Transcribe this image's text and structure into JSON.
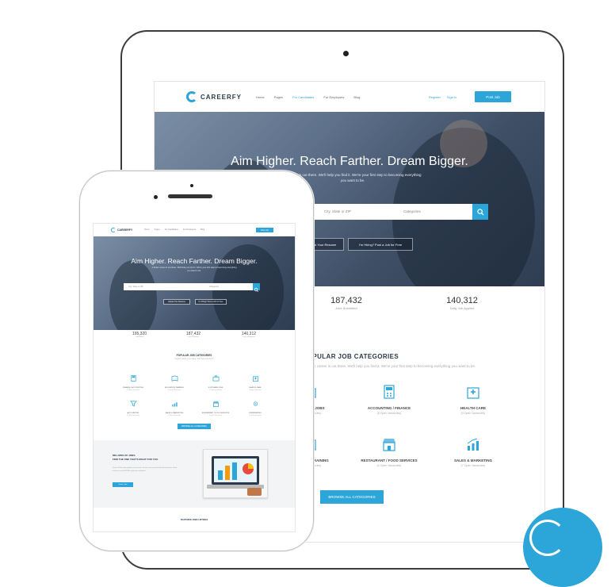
{
  "colors": {
    "accent": "#2ca5d8",
    "dark": "#2b3a4a"
  },
  "tablet": {
    "brand": "CAREERFY",
    "nav": [
      "Home",
      "Pages",
      "For Candidates",
      "For Employers",
      "Blog"
    ],
    "nav_right": [
      "Register",
      "Sign In"
    ],
    "post_job": "Post Job",
    "hero_title": "Aim Higher. Reach Farther. Dream Bigger.",
    "hero_subtitle": "Careerfy is out there. We'll help you find it. We're your first step to becoming everything you want to be.",
    "search_location": "City, State or ZIP",
    "search_category": "Categories",
    "cta_upload": "Upload Your Resume",
    "cta_hiring": "I'm Hiring? Post a Job for Free",
    "stats": [
      {
        "value": "187,432",
        "label": "Jobs Submitted"
      },
      {
        "value": "140,312",
        "label": "Daily Job Applied"
      }
    ],
    "categories_title": "POPULAR JOB CATEGORIES",
    "categories_subtitle": "A better career is out there. We'll help you find it. We're your first step to becoming everything you want to be.",
    "categories": [
      {
        "name": "SOFTWARE JOBS",
        "count": "(5 Open Vacancies)",
        "icon": "briefcase-icon"
      },
      {
        "name": "ACCOUNTING / FINANCE",
        "count": "(8 Open Vacancies)",
        "icon": "calculator-icon"
      },
      {
        "name": "HEALTH CARE",
        "count": "(3 Open Vacancies)",
        "icon": "hospital-icon"
      },
      {
        "name": "EDUCATION TRAINING",
        "count": "(6 Open Vacancies)",
        "icon": "book-icon"
      },
      {
        "name": "RESTAURANT / FOOD SERVICES",
        "count": "(4 Open Vacancies)",
        "icon": "store-icon"
      },
      {
        "name": "SALES & MARKETING",
        "count": "(7 Open Vacancies)",
        "icon": "chart-icon"
      }
    ],
    "browse_label": "BROWSE ALL CATEGORIES"
  },
  "phone": {
    "brand": "CAREERFY",
    "nav": [
      "Home",
      "Pages",
      "For Candidates",
      "For Employers",
      "Blog"
    ],
    "post_job": "Post Job",
    "hero_title": "Aim Higher. Reach Farther. Dream Bigger.",
    "hero_subtitle": "A better career is out there. We'll help you find it. We're your first step to becoming everything you want to be.",
    "search_location": "City, State or ZIP",
    "search_category": "Categories",
    "cta_upload": "Upload Your Resume",
    "cta_hiring": "I'm Hiring? Post a Job for Free",
    "stats": [
      {
        "value": "195,320",
        "label": "Jobs Added"
      },
      {
        "value": "187,432",
        "label": "Jobs Submitted"
      },
      {
        "value": "140,312",
        "label": "Daily Job Applied"
      }
    ],
    "categories_title": "POPULAR JOB CATEGORIES",
    "categories_subtitle": "A better career is out there. We'll help you find it.",
    "categories": [
      {
        "name": "FINANCE / ACCOUNTING",
        "count": "(4 Open Vacancies)"
      },
      {
        "name": "EDUCATION TRAINING",
        "count": "(6 Open Vacancies)"
      },
      {
        "name": "SOFTWARE JOBS",
        "count": "(5 Open Vacancies)"
      },
      {
        "name": "HEALTH CARE",
        "count": "(3 Open Vacancies)"
      },
      {
        "name": "ACCOUNTING",
        "count": "(2 Open Vacancies)"
      },
      {
        "name": "SALES & MARKETING",
        "count": "(7 Open Vacancies)"
      },
      {
        "name": "RESTAURANT / FOOD SERVICES",
        "count": "(4 Open Vacancies)"
      },
      {
        "name": "ENGINEERING",
        "count": "(5 Open Vacancies)"
      }
    ],
    "browse_label": "BROWSE ALL CATEGORIES",
    "promo_title": "MILLIONS OF JOBS.\nFIND THE ONE THAT'S RIGHT FOR YOU.",
    "promo_text": "Search all the open positions on the web. Get your own personalized salary estimate. Read reviews on over 600,000 companies worldwide.",
    "promo_button": "Search Jobs",
    "featured_title": "FEATURED JOBS LISTINGS"
  }
}
